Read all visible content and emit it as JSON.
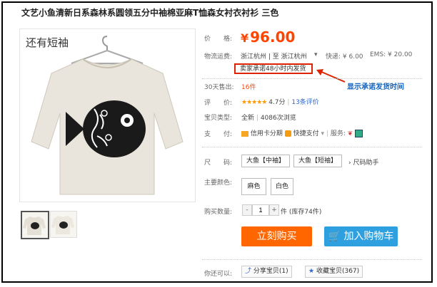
{
  "product": {
    "title": "文艺小鱼清新日系森林系圆领五分中袖棉亚麻T恤森女衬衣衬衫 三色",
    "image_overlay": "还有短袖",
    "price_label": "价　　格:",
    "price_currency": "¥",
    "price_value": "96.00"
  },
  "shipping": {
    "label": "物流运费:",
    "route": "浙江杭州 | 至 浙江杭州",
    "express": "快递: ¥ 6.00",
    "ems": "EMS: ¥ 20.00",
    "commitment": "卖家承诺48小时内发货"
  },
  "annotation": "显示承诺发货时间",
  "sales": {
    "label": "30天售出:",
    "value": "16件"
  },
  "rating": {
    "label": "评　　价:",
    "stars": "★★★★★",
    "score": "4.7分",
    "reviews": "13条评价"
  },
  "type": {
    "label": "宝贝类型:",
    "condition": "全新",
    "views": "4086次浏览"
  },
  "payment": {
    "label": "支　　付:",
    "credit": "信用卡分期",
    "fast": "快捷支付",
    "service_label": "服务:"
  },
  "size": {
    "label": "尺　　码:",
    "options": [
      "大鱼【中袖】",
      "大鱼【短袖】"
    ],
    "helper": "尺码助手"
  },
  "color": {
    "label": "主要颜色:",
    "options": [
      "麻色",
      "白色"
    ]
  },
  "quantity": {
    "label": "购买数量:",
    "minus": "-",
    "value": "1",
    "plus": "+",
    "stock": "件 (库存74件)"
  },
  "actions": {
    "buy": "立刻购买",
    "cart": "加入购物车"
  },
  "social": {
    "label": "你还可以:",
    "share": "分享宝贝(1)",
    "fav": "收藏宝贝(367)"
  },
  "colors": {
    "accent": "#ff6600",
    "price": "#ff4400",
    "cart": "#2ea0e0",
    "annotation": "#1565c0",
    "highlight": "#dd2200"
  }
}
